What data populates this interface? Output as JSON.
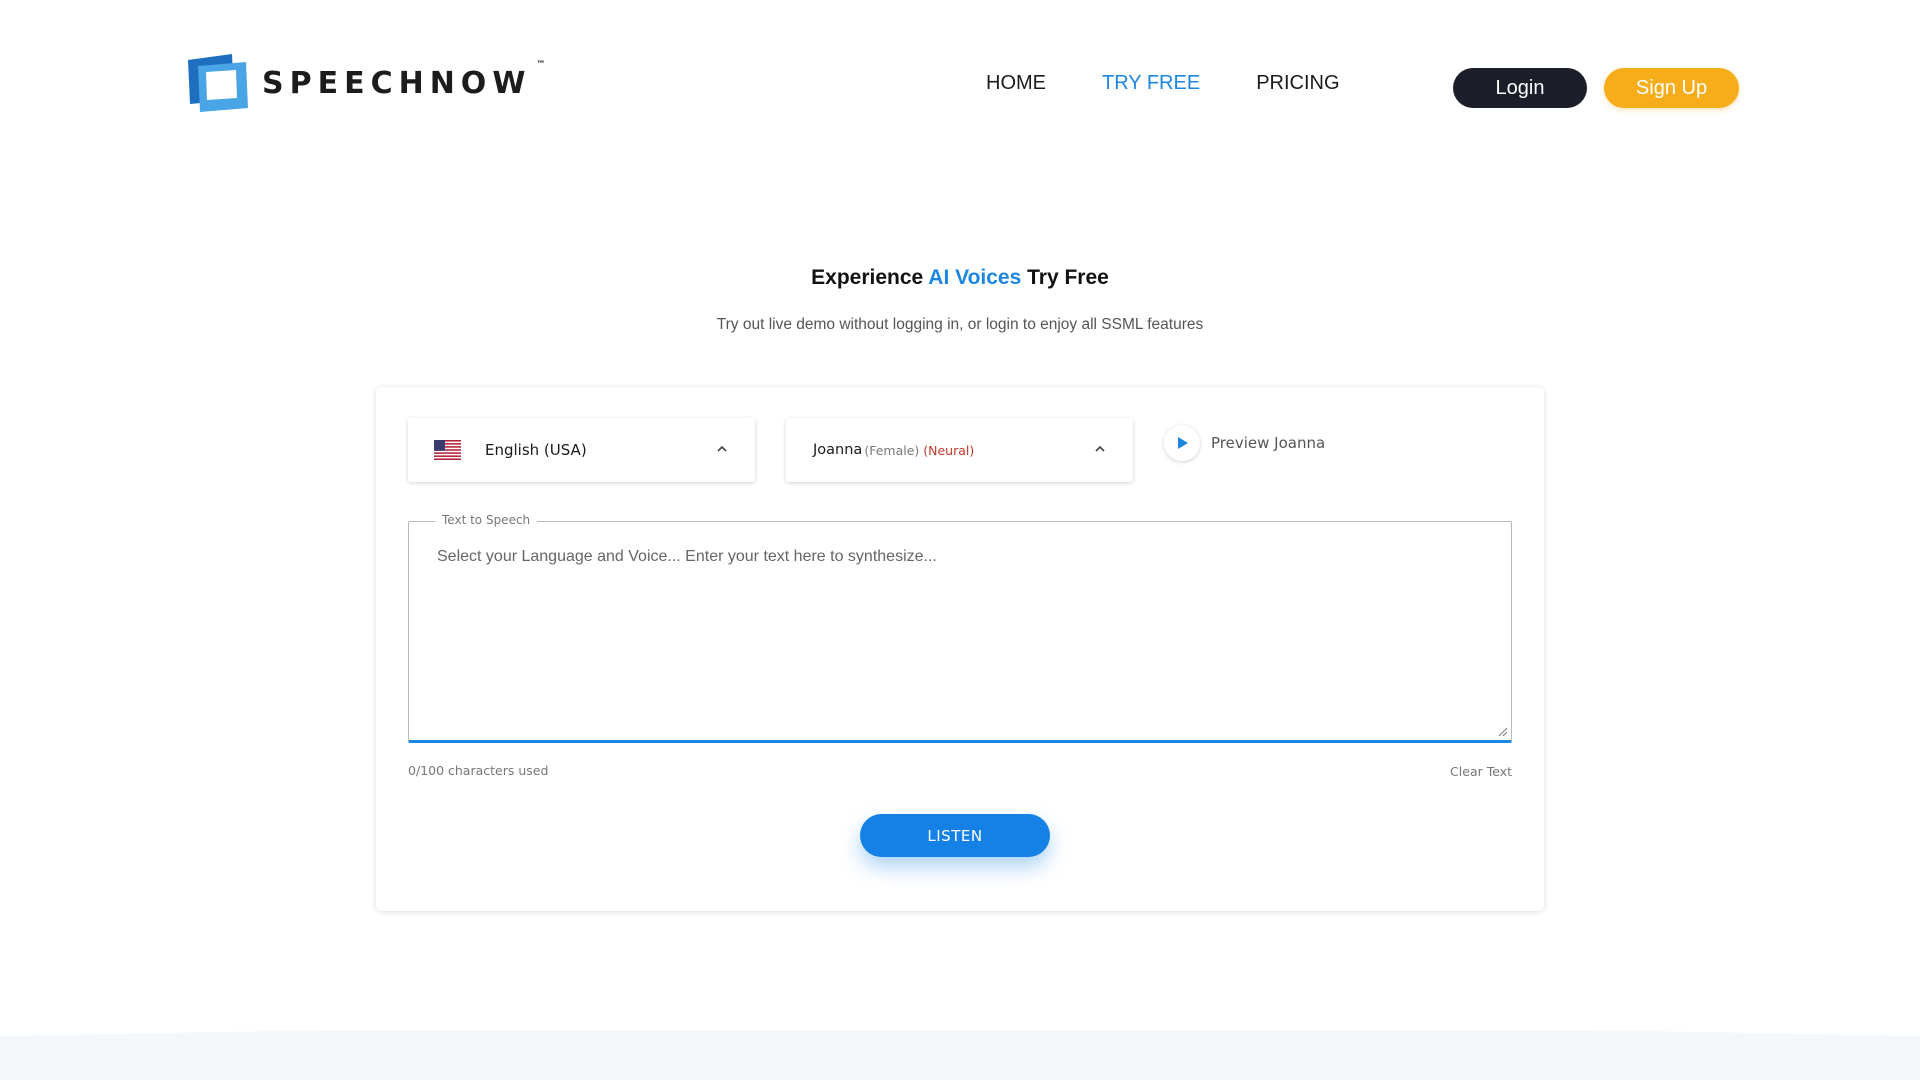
{
  "brand": {
    "name": "SPEECHNOW",
    "trademark": "™"
  },
  "nav": {
    "home": "HOME",
    "try_free": "TRY FREE",
    "pricing": "PRICING"
  },
  "auth": {
    "login": "Login",
    "signup": "Sign Up"
  },
  "hero": {
    "title_pre": "Experience ",
    "title_accent": "AI Voices",
    "title_post": " Try Free",
    "subtitle": "Try out live demo without logging in, or login to enjoy all SSML features"
  },
  "demo": {
    "language": {
      "label": "English (USA)",
      "flag": "us-flag-icon"
    },
    "voice": {
      "name": "Joanna",
      "gender": "(Female)",
      "engine": "(Neural)"
    },
    "preview_label": "Preview Joanna",
    "textarea": {
      "legend": "Text to Speech",
      "placeholder": "Select your Language and Voice... Enter your text here to synthesize...",
      "value": ""
    },
    "char_count": "0/100 characters used",
    "clear_label": "Clear Text",
    "listen_label": "LISTEN"
  },
  "colors": {
    "accent": "#1d86e0",
    "login_bg": "#1c1f2a",
    "signup_bg": "#f7ac1a",
    "listen_bg": "#1581e7",
    "neural_tag": "#c0392b"
  }
}
